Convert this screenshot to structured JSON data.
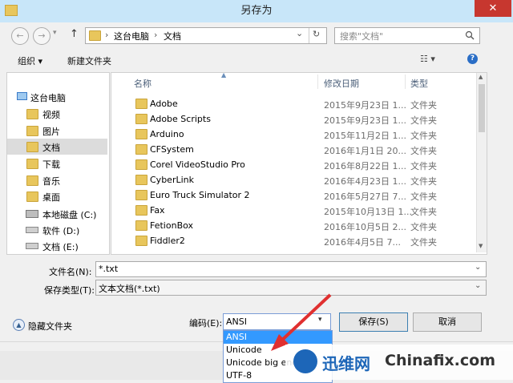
{
  "window": {
    "title": "另存为",
    "close": "✕"
  },
  "nav": {
    "back": "←",
    "forward": "→",
    "up": "↑",
    "breadcrumb": [
      "这台电脑",
      "文档"
    ],
    "sep": "›",
    "dropdown": "⌄",
    "refresh": "↻",
    "search_placeholder": "搜索\"文档\"",
    "search_icon": "search-icon"
  },
  "toolbar": {
    "organize": "组织 ▾",
    "new_folder": "新建文件夹",
    "view": "☷ ▾",
    "help": "?"
  },
  "sidebar": {
    "items": [
      {
        "label": "这台电脑",
        "icon": "computer-icon"
      },
      {
        "label": "视频",
        "icon": "video-folder-icon"
      },
      {
        "label": "图片",
        "icon": "pictures-folder-icon"
      },
      {
        "label": "文档",
        "icon": "documents-folder-icon"
      },
      {
        "label": "下载",
        "icon": "downloads-folder-icon"
      },
      {
        "label": "音乐",
        "icon": "music-folder-icon"
      },
      {
        "label": "桌面",
        "icon": "desktop-folder-icon"
      },
      {
        "label": "本地磁盘 (C:)",
        "icon": "disk-icon"
      },
      {
        "label": "软件 (D:)",
        "icon": "drive-icon"
      },
      {
        "label": "文档 (E:)",
        "icon": "drive-icon"
      }
    ]
  },
  "columns": {
    "name": "名称",
    "modified": "修改日期",
    "type": "类型"
  },
  "files": [
    {
      "name": "Adobe",
      "date": "2015年9月23日 1...",
      "type": "文件夹"
    },
    {
      "name": "Adobe Scripts",
      "date": "2015年9月23日 1...",
      "type": "文件夹"
    },
    {
      "name": "Arduino",
      "date": "2015年11月2日 1...",
      "type": "文件夹"
    },
    {
      "name": "CFSystem",
      "date": "2016年1月1日 20...",
      "type": "文件夹"
    },
    {
      "name": "Corel VideoStudio Pro",
      "date": "2016年8月22日 1...",
      "type": "文件夹"
    },
    {
      "name": "CyberLink",
      "date": "2016年4月23日 1...",
      "type": "文件夹"
    },
    {
      "name": "Euro Truck Simulator 2",
      "date": "2016年5月27日 7...",
      "type": "文件夹"
    },
    {
      "name": "Fax",
      "date": "2015年10月13日 1...",
      "type": "文件夹"
    },
    {
      "name": "FetionBox",
      "date": "2016年10月5日 2...",
      "type": "文件夹"
    },
    {
      "name": "Fiddler2",
      "date": "2016年4月5日 7...",
      "type": "文件夹"
    }
  ],
  "form": {
    "filename_label": "文件名(N):",
    "filename_value": "*.txt",
    "type_label": "保存类型(T):",
    "type_value": "文本文档(*.txt)",
    "hide_folders": "隐藏文件夹",
    "encoding_label": "编码(E):",
    "encoding_value": "ANSI",
    "save": "保存(S)",
    "cancel": "取消"
  },
  "encoding_options": [
    "ANSI",
    "Unicode",
    "Unicode big endian",
    "UTF-8"
  ],
  "watermark": {
    "cn": "迅维网",
    "en": "Chinafix.com"
  },
  "colors": {
    "accent": "#c8e6f9",
    "selected": "#cce8ff",
    "arrow": "#e03030",
    "close": "#c7372f"
  }
}
